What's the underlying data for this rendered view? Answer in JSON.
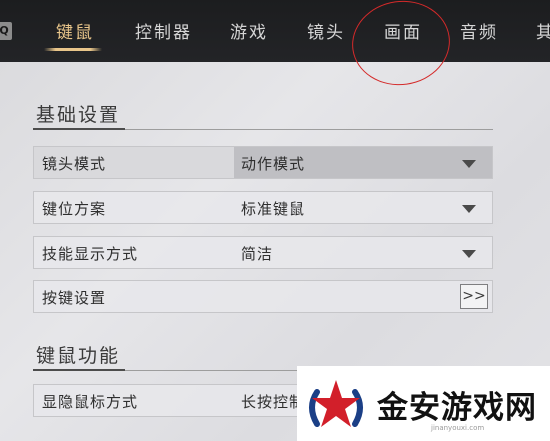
{
  "nav": {
    "key_badge": "Q",
    "tabs": [
      {
        "label": "键鼠",
        "active": true
      },
      {
        "label": "控制器",
        "active": false
      },
      {
        "label": "游戏",
        "active": false
      },
      {
        "label": "镜头",
        "active": false
      },
      {
        "label": "画面",
        "active": false
      },
      {
        "label": "音频",
        "active": false
      },
      {
        "label": "其",
        "active": false
      }
    ]
  },
  "sections": [
    {
      "title": "基础设置",
      "rows": [
        {
          "label": "镜头模式",
          "value": "动作模式",
          "control": "dropdown"
        },
        {
          "label": "键位方案",
          "value": "标准键鼠",
          "control": "dropdown"
        },
        {
          "label": "技能显示方式",
          "value": "简洁",
          "control": "dropdown"
        },
        {
          "label": "按键设置",
          "value": "",
          "control": "arrow",
          "button_label": ">>"
        }
      ]
    },
    {
      "title": "键鼠功能",
      "rows": [
        {
          "label": "显隐鼠标方式",
          "value": "长按控制",
          "control": "dropdown"
        }
      ]
    }
  ],
  "watermark": {
    "text": "金安游戏网",
    "subtext": "jinanyouxi.com"
  },
  "colors": {
    "tab_active": "#e8c58a",
    "tab_inactive": "#d6d6d6",
    "annotation_circle": "#d42a2a",
    "topbar_bg": "#1c1d1f"
  }
}
